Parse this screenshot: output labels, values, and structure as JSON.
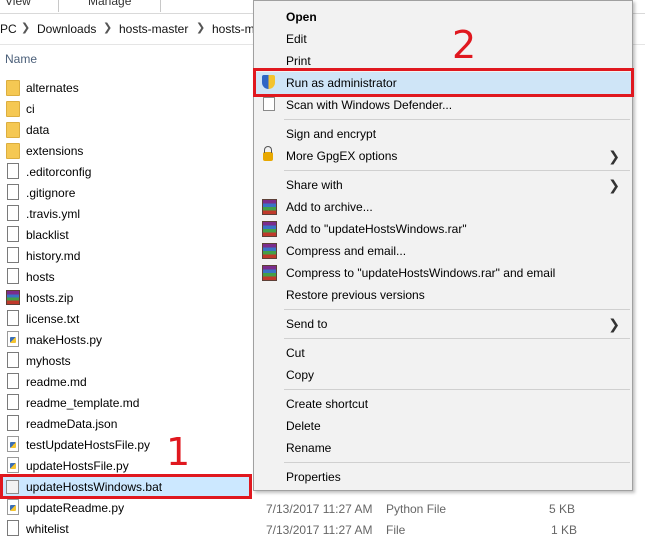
{
  "ribbon": {
    "tab_view": "View",
    "tab_manage": "Manage"
  },
  "address": {
    "breadcrumbs": [
      "PC",
      "Downloads",
      "hosts-master",
      "hosts-m"
    ]
  },
  "columns": {
    "name": "Name"
  },
  "files": [
    {
      "name": "alternates",
      "icon": "folder-icon"
    },
    {
      "name": "ci",
      "icon": "folder-icon"
    },
    {
      "name": "data",
      "icon": "folder-icon"
    },
    {
      "name": "extensions",
      "icon": "folder-icon"
    },
    {
      "name": ".editorconfig",
      "icon": "document-icon"
    },
    {
      "name": ".gitignore",
      "icon": "document-icon"
    },
    {
      "name": ".travis.yml",
      "icon": "document-icon"
    },
    {
      "name": "blacklist",
      "icon": "document-icon"
    },
    {
      "name": "history.md",
      "icon": "document-icon"
    },
    {
      "name": "hosts",
      "icon": "document-icon"
    },
    {
      "name": "hosts.zip",
      "icon": "winrar-archive-icon"
    },
    {
      "name": "license.txt",
      "icon": "text-file-icon"
    },
    {
      "name": "makeHosts.py",
      "icon": "python-file-icon"
    },
    {
      "name": "myhosts",
      "icon": "document-icon"
    },
    {
      "name": "readme.md",
      "icon": "document-icon"
    },
    {
      "name": "readme_template.md",
      "icon": "document-icon"
    },
    {
      "name": "readmeData.json",
      "icon": "document-icon"
    },
    {
      "name": "testUpdateHostsFile.py",
      "icon": "python-file-icon"
    },
    {
      "name": "updateHostsFile.py",
      "icon": "python-file-icon"
    },
    {
      "name": "updateHostsWindows.bat",
      "icon": "batch-file-icon",
      "selected": true
    },
    {
      "name": "updateReadme.py",
      "icon": "python-file-icon",
      "date": "7/13/2017 11:27 AM",
      "type": "Python File",
      "size": "5 KB"
    },
    {
      "name": "whitelist",
      "icon": "document-icon",
      "date": "7/13/2017 11:27 AM",
      "type": "File",
      "size": "1 KB"
    }
  ],
  "context_menu": {
    "open": "Open",
    "edit": "Edit",
    "print": "Print",
    "run_as_admin": "Run as administrator",
    "scan_defender": "Scan with Windows Defender...",
    "sign_encrypt": "Sign and encrypt",
    "gpgex": "More GpgEX options",
    "share_with": "Share with",
    "add_archive": "Add to archive...",
    "add_rar": "Add to \"updateHostsWindows.rar\"",
    "compress_email": "Compress and email...",
    "compress_rar_email": "Compress to \"updateHostsWindows.rar\" and email",
    "restore_versions": "Restore previous versions",
    "send_to": "Send to",
    "cut": "Cut",
    "copy": "Copy",
    "create_shortcut": "Create shortcut",
    "delete": "Delete",
    "rename": "Rename",
    "properties": "Properties"
  },
  "annotations": {
    "step1": "1",
    "step2": "2",
    "accent_color": "#e0181f"
  }
}
